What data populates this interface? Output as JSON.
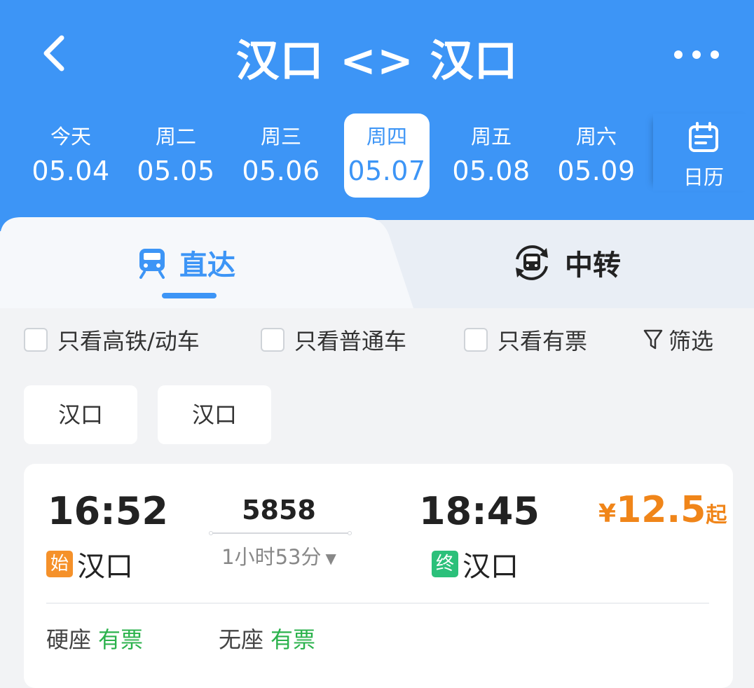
{
  "header": {
    "title": "汉口 <> 汉口",
    "back_icon": "chevron-left-icon",
    "more_icon": "more-dots-icon",
    "color": "#3d95f6"
  },
  "dates": [
    {
      "weekday": "今天",
      "date": "05.04",
      "selected": false
    },
    {
      "weekday": "周二",
      "date": "05.05",
      "selected": false
    },
    {
      "weekday": "周三",
      "date": "05.06",
      "selected": false
    },
    {
      "weekday": "周四",
      "date": "05.07",
      "selected": true
    },
    {
      "weekday": "周五",
      "date": "05.08",
      "selected": false
    },
    {
      "weekday": "周六",
      "date": "05.09",
      "selected": false
    }
  ],
  "calendar": {
    "label": "日历",
    "icon": "calendar-icon"
  },
  "tabs": [
    {
      "label": "直达",
      "icon": "train-icon",
      "active": true
    },
    {
      "label": "中转",
      "icon": "transfer-train-icon",
      "active": false
    }
  ],
  "filters": {
    "high_speed_only": "只看高铁/动车",
    "normal_only": "只看普通车",
    "available_only": "只看有票",
    "filter_label": "筛选",
    "filter_icon": "funnel-icon"
  },
  "station_chips": [
    "汉口",
    "汉口"
  ],
  "trains": [
    {
      "depart_time": "16:52",
      "depart_badge": "始",
      "depart_station": "汉口",
      "train_number": "5858",
      "duration": "1小时53分",
      "arrive_time": "18:45",
      "arrive_badge": "终",
      "arrive_station": "汉口",
      "price_currency": "¥",
      "price": "12.5",
      "price_suffix": "起",
      "seats": [
        {
          "type": "硬座",
          "status": "有票"
        },
        {
          "type": "无座",
          "status": "有票"
        }
      ]
    }
  ],
  "colors": {
    "accent": "#3d95f6",
    "price": "#f08519",
    "available": "#2bb24c",
    "start_badge": "#f5912a",
    "end_badge": "#2bc07a"
  }
}
